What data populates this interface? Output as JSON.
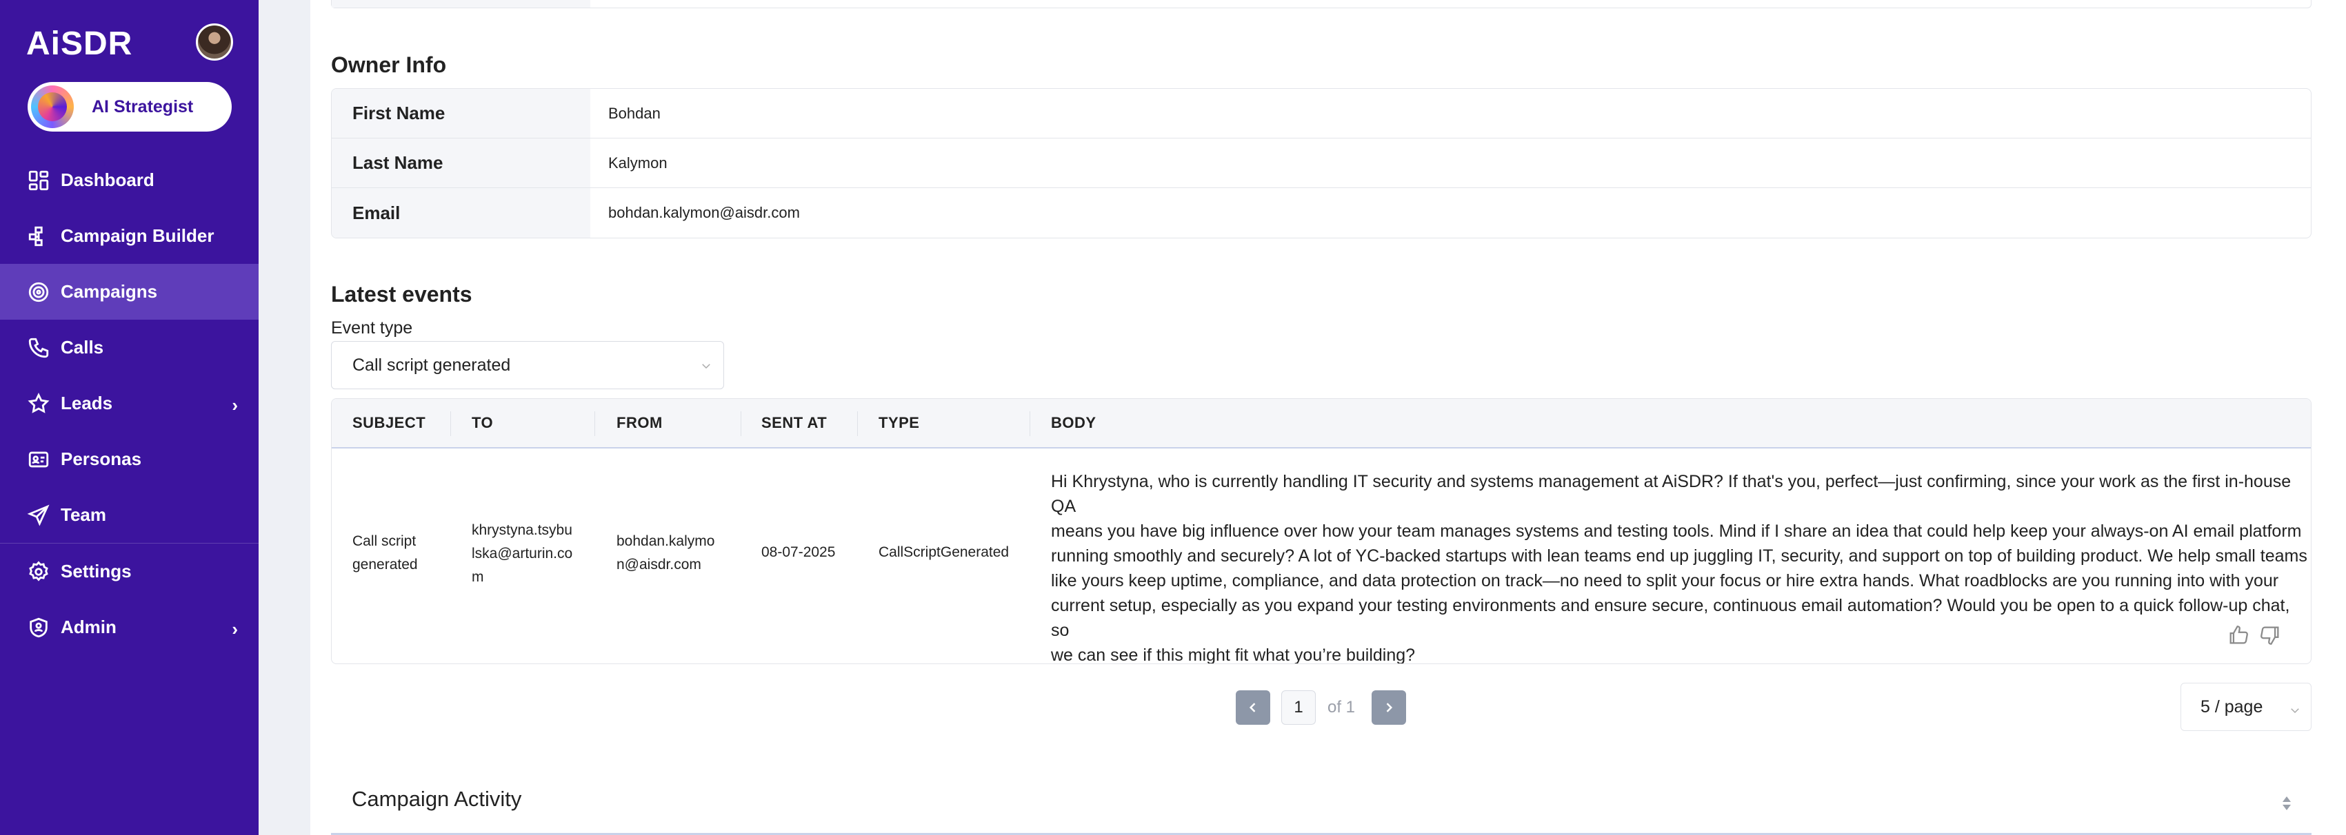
{
  "app": {
    "logo": "AiSDR",
    "strategist_label": "AI Strategist"
  },
  "sidebar": {
    "items": [
      {
        "label": "Dashboard",
        "icon": "dashboard-icon"
      },
      {
        "label": "Campaign Builder",
        "icon": "campaign-builder-icon"
      },
      {
        "label": "Campaigns",
        "icon": "target-icon",
        "active": true
      },
      {
        "label": "Calls",
        "icon": "phone-icon"
      },
      {
        "label": "Leads",
        "icon": "star-icon",
        "expandable": true
      },
      {
        "label": "Personas",
        "icon": "id-card-icon"
      },
      {
        "label": "Team",
        "icon": "send-icon"
      },
      {
        "label": "Settings",
        "icon": "gear-icon"
      },
      {
        "label": "Admin",
        "icon": "shield-icon",
        "expandable": true
      }
    ]
  },
  "owner_info": {
    "title": "Owner Info",
    "rows": [
      {
        "label": "First Name",
        "value": "Bohdan"
      },
      {
        "label": "Last Name",
        "value": "Kalymon"
      },
      {
        "label": "Email",
        "value": "bohdan.kalymon@aisdr.com"
      }
    ]
  },
  "latest_events": {
    "title": "Latest events",
    "event_type_label": "Event type",
    "event_type_value": "Call script generated",
    "columns": [
      "SUBJECT",
      "TO",
      "FROM",
      "SENT AT",
      "TYPE",
      "BODY"
    ],
    "rows": [
      {
        "subject_lines": [
          "Call script",
          "generated"
        ],
        "to_lines": [
          "khrystyna.tsybu",
          "lska@arturin.co",
          "m"
        ],
        "from_lines": [
          "bohdan.kalymo",
          "n@aisdr.com"
        ],
        "sent_at": "08-07-2025",
        "type": "CallScriptGenerated",
        "body_lines": [
          "Hi Khrystyna, who is currently handling IT security and systems management at AiSDR? If that's you, perfect—just confirming, since your work as the first in-house QA",
          "means you have big influence over how your team manages systems and testing tools. Mind if I share an idea that could help keep your always-on AI email platform",
          "running smoothly and securely? A lot of YC-backed startups with lean teams end up juggling IT, security, and support on top of building product. We help small teams",
          "like yours keep uptime, compliance, and data protection on track—no need to split your focus or hire extra hands. What roadblocks are you running into with your",
          "current setup, especially as you expand your testing environments and ensure secure, continuous email automation? Would you be open to a quick follow-up chat, so",
          "we can see if this might fit what you’re building?"
        ]
      }
    ],
    "pagination": {
      "current": "1",
      "of_label": "of 1",
      "page_size": "5 / page"
    }
  },
  "campaign_activity": {
    "title": "Campaign Activity"
  }
}
